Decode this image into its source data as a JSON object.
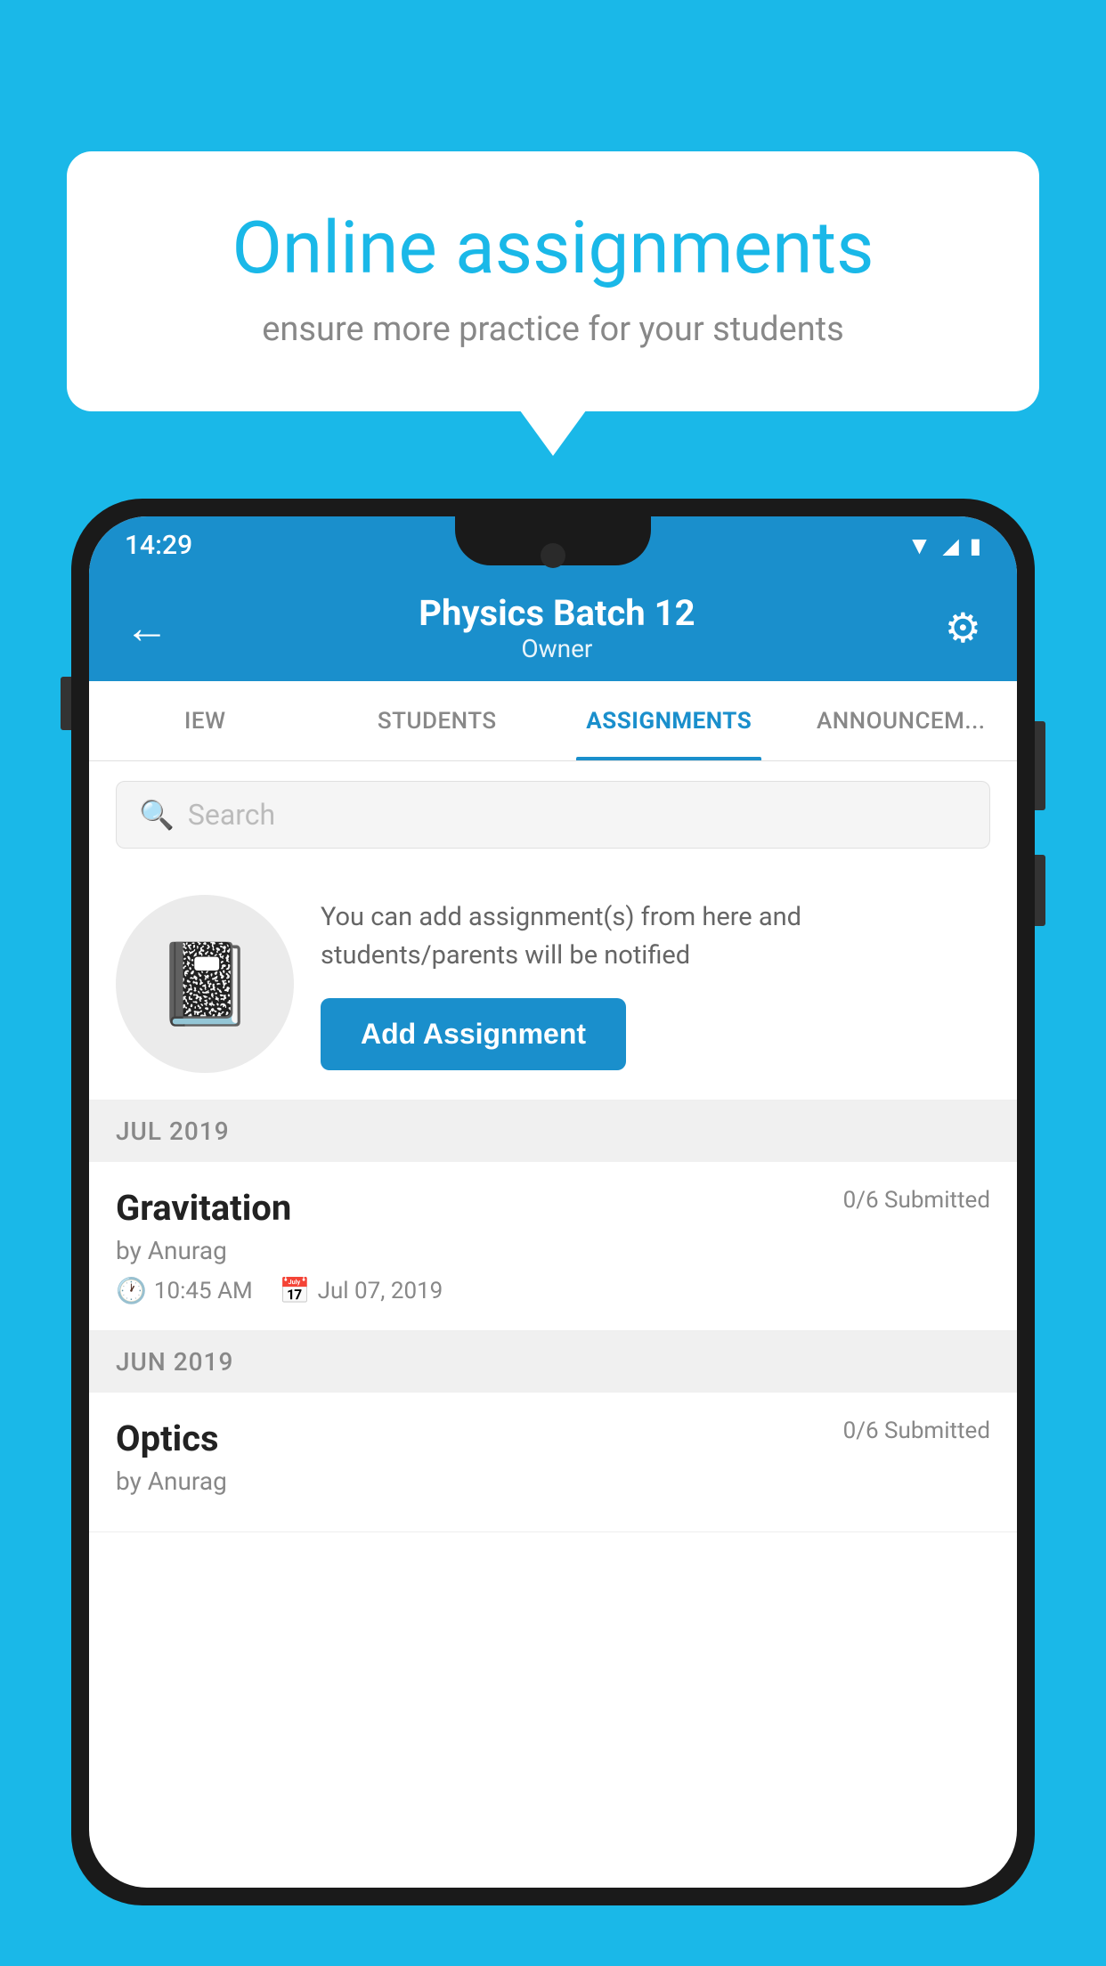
{
  "background_color": "#1AB8E8",
  "speech_bubble": {
    "title": "Online assignments",
    "subtitle": "ensure more practice for your students"
  },
  "phone": {
    "status_bar": {
      "time": "14:29",
      "wifi_icon": "wifi",
      "signal_icon": "signal",
      "battery_icon": "battery"
    },
    "header": {
      "title": "Physics Batch 12",
      "subtitle": "Owner",
      "back_label": "←",
      "settings_label": "⚙"
    },
    "tabs": [
      {
        "label": "IEW",
        "active": false
      },
      {
        "label": "STUDENTS",
        "active": false
      },
      {
        "label": "ASSIGNMENTS",
        "active": true
      },
      {
        "label": "ANNOUNCEM...",
        "active": false
      }
    ],
    "search": {
      "placeholder": "Search"
    },
    "promo": {
      "description": "You can add assignment(s) from here and students/parents will be notified",
      "button_label": "Add Assignment"
    },
    "sections": [
      {
        "label": "JUL 2019",
        "assignments": [
          {
            "name": "Gravitation",
            "submitted": "0/6 Submitted",
            "author": "by Anurag",
            "time": "10:45 AM",
            "date": "Jul 07, 2019"
          }
        ]
      },
      {
        "label": "JUN 2019",
        "assignments": [
          {
            "name": "Optics",
            "submitted": "0/6 Submitted",
            "author": "by Anurag",
            "time": "",
            "date": ""
          }
        ]
      }
    ]
  }
}
